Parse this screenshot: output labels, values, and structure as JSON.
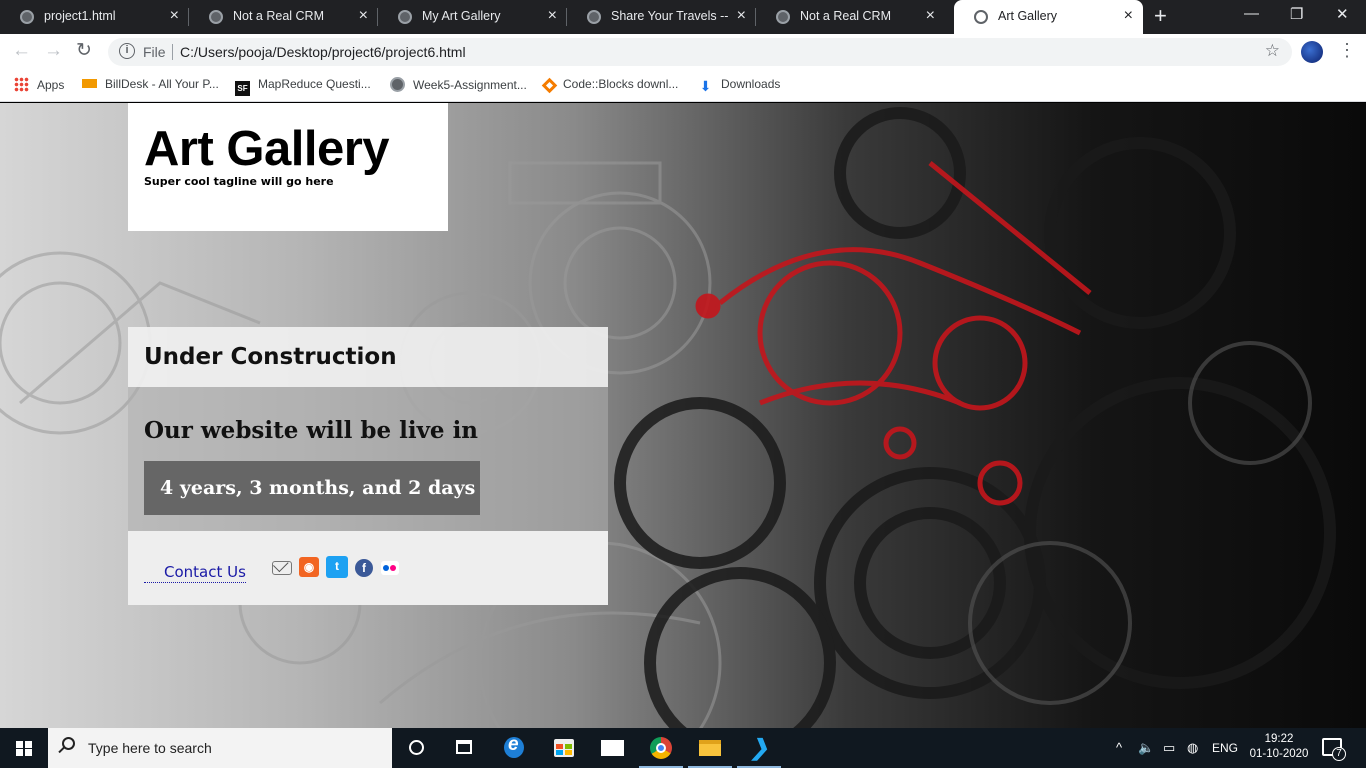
{
  "browser": {
    "tabs": [
      {
        "title": "project1.html",
        "active": false
      },
      {
        "title": "Not a Real CRM",
        "active": false
      },
      {
        "title": "My Art Gallery",
        "active": false
      },
      {
        "title": "Share Your Travels -- M",
        "active": false
      },
      {
        "title": "Not a Real CRM",
        "active": false
      },
      {
        "title": "Art Gallery",
        "active": true
      }
    ],
    "tab_close_glyph": "×",
    "new_tab_glyph": "+",
    "window_controls": {
      "minimize": "—",
      "restore": "❐",
      "close": "✕"
    },
    "nav": {
      "back": "←",
      "forward": "→",
      "reload": "↻"
    },
    "address": {
      "scheme_label": "File",
      "url": "C:/Users/pooja/Desktop/project6/project6.html",
      "info_glyph": "i",
      "star_glyph": "☆"
    },
    "menu_glyph": "⋮",
    "bookmarks": [
      {
        "label": "Apps",
        "icon": "apps-grid-icon"
      },
      {
        "label": "BillDesk - All Your P...",
        "icon": "billdesk-icon"
      },
      {
        "label": "MapReduce Questi...",
        "icon": "sf-icon"
      },
      {
        "label": "Week5-Assignment...",
        "icon": "globe-icon"
      },
      {
        "label": "Code::Blocks downl...",
        "icon": "codeblocks-icon"
      },
      {
        "label": "Downloads",
        "icon": "download-icon"
      }
    ],
    "sf_icon_text": "SF",
    "download_glyph": "⬇"
  },
  "page": {
    "site_title": "Art Gallery",
    "tagline": "Super cool tagline will go here",
    "section_heading": "Under Construction",
    "live_heading": "Our website will be live in",
    "countdown": "4 years, 3 months, and 2 days",
    "contact_label": "Contact Us",
    "social_icons": [
      "mail-icon",
      "rss-icon",
      "twitter-icon",
      "facebook-icon",
      "flickr-icon"
    ],
    "rss_glyph": "◉",
    "twitter_glyph": "t",
    "facebook_glyph": "f",
    "colors": {
      "accent_red": "#c4161c",
      "link": "#1a1aa6",
      "countdown_bg": "#666666"
    }
  },
  "taskbar": {
    "search_placeholder": "Type here to search",
    "tray": {
      "chevron": "^",
      "volume": "🔈",
      "battery": "▭",
      "network": "◍",
      "language": "ENG"
    },
    "time": "19:22",
    "date": "01-10-2020",
    "notification_count": "7"
  }
}
